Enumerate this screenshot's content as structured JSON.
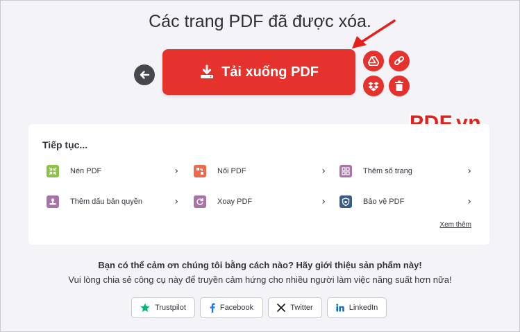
{
  "header": {
    "title": "Các trang PDF đã được xóa."
  },
  "actions": {
    "download_label": "Tải xuống PDF",
    "back_icon": "arrow-left-icon",
    "cloud_icons": [
      "google-drive-icon",
      "link-icon",
      "dropbox-icon",
      "trash-icon"
    ]
  },
  "watermark": {
    "text": "PDF.vn"
  },
  "continue": {
    "title": "Tiếp tục...",
    "tools": [
      {
        "label": "Nén PDF",
        "icon": "compress-icon",
        "color": "#8bc34a"
      },
      {
        "label": "Nối PDF",
        "icon": "merge-icon",
        "color": "#ec6a4d"
      },
      {
        "label": "Thêm số trang",
        "icon": "page-numbers-icon",
        "color": "#a874a6"
      },
      {
        "label": "Thêm dấu bản quyền",
        "icon": "watermark-icon",
        "color": "#a874a6"
      },
      {
        "label": "Xoay PDF",
        "icon": "rotate-icon",
        "color": "#a874a6"
      },
      {
        "label": "Bảo vệ PDF",
        "icon": "shield-icon",
        "color": "#3a5e8c"
      }
    ],
    "see_more": "Xem thêm"
  },
  "share": {
    "line1": "Bạn có thể cảm ơn chúng tôi bằng cách nào? Hãy giới thiệu sản phẩm này!",
    "line2": "Vui lòng chia sẻ công cụ này để truyền cảm hứng cho nhiều người làm việc năng suất hơn nữa!",
    "buttons": [
      {
        "label": "Trustpilot",
        "icon": "trustpilot-star-icon",
        "color": "#00b67a"
      },
      {
        "label": "Facebook",
        "icon": "facebook-icon",
        "color": "#1877f2"
      },
      {
        "label": "Twitter",
        "icon": "x-twitter-icon",
        "color": "#000000"
      },
      {
        "label": "LinkedIn",
        "icon": "linkedin-icon",
        "color": "#0a66c2"
      }
    ]
  },
  "colors": {
    "accent": "#e5322d",
    "background": "#f4f3f8",
    "dark_button": "#47474f"
  }
}
